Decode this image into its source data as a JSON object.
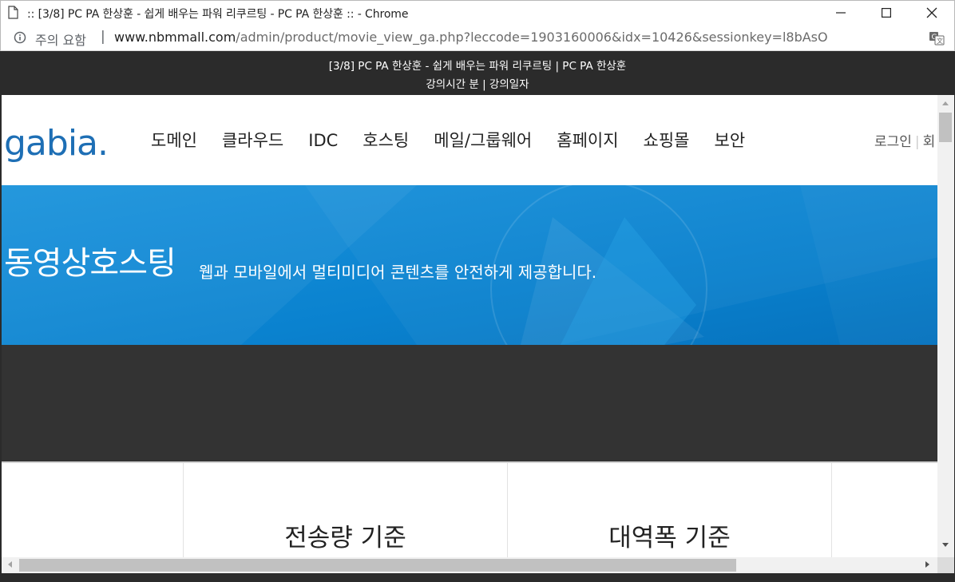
{
  "window": {
    "title": ":: [3/8] PC PA 한상훈 - 쉽게 배우는 파워 리쿠르팅 - PC PA 한상훈 :: - Chrome",
    "icons": {
      "page": "document-icon",
      "minimize": "minimize-icon",
      "maximize": "maximize-icon",
      "close": "close-icon"
    }
  },
  "addressbar": {
    "warning": "주의 요함",
    "separator": "|",
    "url_host": "www.nbmmall.com",
    "url_path": "/admin/product/movie_view_ga.php?leccode=1903160006&idx=10426&sessionkey=l8bAsO",
    "icons": {
      "security": "info-circle-icon",
      "translate": "translate-icon"
    }
  },
  "lecture": {
    "title": "[3/8] PC PA 한상훈 - 쉽게 배우는 파워 리쿠르팅 | PC PA 한상훈",
    "subtitle": "강의시간 분 | 강의일자"
  },
  "site": {
    "logo": "gabia",
    "logo_dot": ".",
    "menu": [
      "도메인",
      "클라우드",
      "IDC",
      "호스팅",
      "메일/그룹웨어",
      "홈페이지",
      "쇼핑몰",
      "보안"
    ],
    "util_login": "로그인",
    "util_bar": "|",
    "util_next": "회"
  },
  "hero": {
    "title": "동영상호스팅",
    "subtitle": "웹과 모바일에서 멀티미디어 콘텐츠를 안전하게 제공합니다."
  },
  "plans": {
    "transfer": "전송량 기준",
    "bandwidth": "대역폭 기준"
  },
  "colors": {
    "hero_blue": "#0a84d0",
    "dark_band": "#333333",
    "brand": "#1e6fb5"
  }
}
